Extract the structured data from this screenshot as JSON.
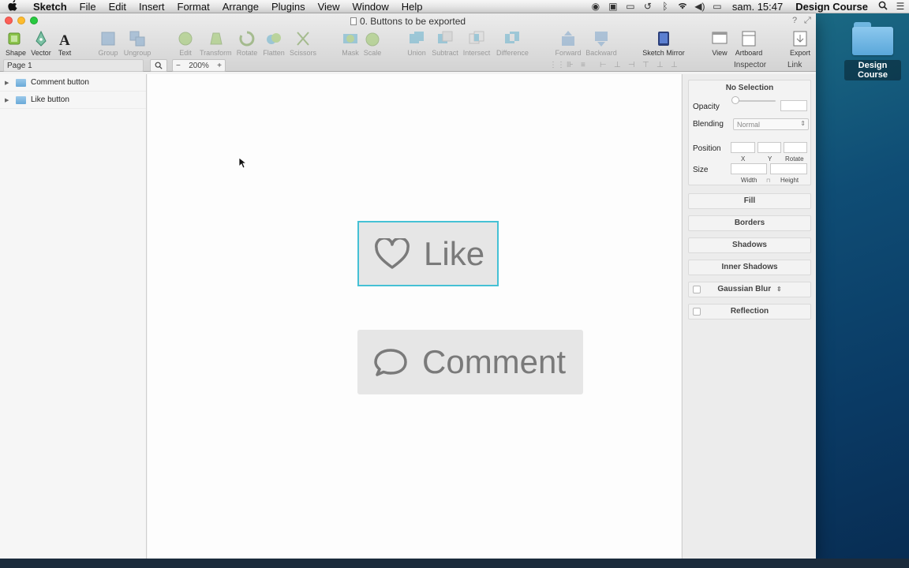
{
  "menubar": {
    "app": "Sketch",
    "items": [
      "File",
      "Edit",
      "Insert",
      "Format",
      "Arrange",
      "Plugins",
      "View",
      "Window",
      "Help"
    ],
    "clock": "sam. 15:47",
    "user": "Design Course"
  },
  "desktop": {
    "folder_label": "Design Course"
  },
  "window": {
    "doc_title": "0. Buttons to be exported"
  },
  "toolbar": {
    "shape": "Shape",
    "vector": "Vector",
    "text": "Text",
    "group": "Group",
    "ungroup": "Ungroup",
    "edit": "Edit",
    "transform": "Transform",
    "rotate": "Rotate",
    "flatten": "Flatten",
    "scissors": "Scissors",
    "mask": "Mask",
    "scale": "Scale",
    "union": "Union",
    "subtract": "Subtract",
    "intersect": "Intersect",
    "difference": "Difference",
    "forward": "Forward",
    "backward": "Backward",
    "sketch_mirror": "Sketch Mirror",
    "view": "View",
    "artboard": "Artboard",
    "export": "Export"
  },
  "subbar": {
    "page": "Page 1",
    "zoom_minus": "−",
    "zoom_value": "200%",
    "zoom_plus": "+",
    "inspector_tab": "Inspector",
    "link_tab": "Link"
  },
  "layers": [
    {
      "name": "Comment button"
    },
    {
      "name": "Like button"
    }
  ],
  "canvas": {
    "like_label": "Like",
    "comment_label": "Comment"
  },
  "inspector": {
    "title": "No Selection",
    "opacity_label": "Opacity",
    "blending_label": "Blending",
    "blending_value": "Normal",
    "position_label": "Position",
    "x_label": "X",
    "y_label": "Y",
    "rotate_label": "Rotate",
    "size_label": "Size",
    "width_label": "Width",
    "height_label": "Height",
    "fill": "Fill",
    "borders": "Borders",
    "shadows": "Shadows",
    "inner_shadows": "Inner Shadows",
    "gaussian_blur": "Gaussian Blur",
    "reflection": "Reflection"
  },
  "colors": {
    "selection_outline": "#45c1d5",
    "button_fill": "#e6e6e6",
    "button_text": "#7a7a7a"
  }
}
